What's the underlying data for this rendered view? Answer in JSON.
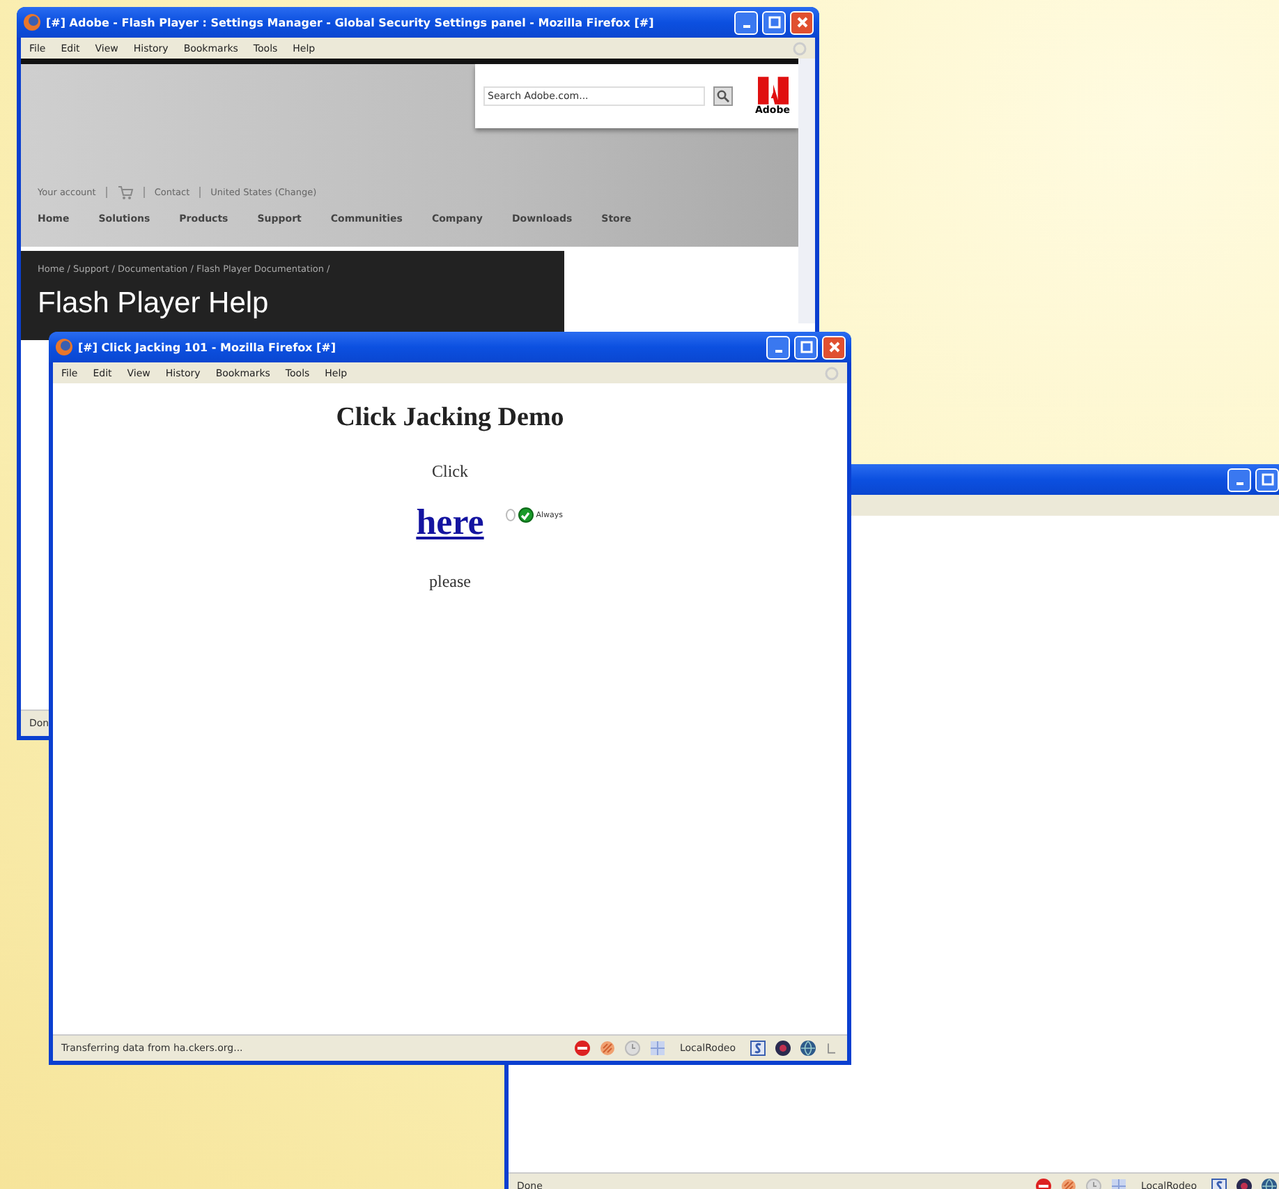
{
  "adobe_window": {
    "title": "[#] Adobe - Flash Player : Settings Manager - Global Security Settings panel - Mozilla Firefox [#]",
    "menu": [
      "File",
      "Edit",
      "View",
      "History",
      "Bookmarks",
      "Tools",
      "Help"
    ],
    "search": {
      "placeholder": "Search Adobe.com..."
    },
    "logo_text": "Adobe",
    "utility_links": [
      "Your account",
      "Contact",
      "United States (Change)"
    ],
    "nav": [
      "Home",
      "Solutions",
      "Products",
      "Support",
      "Communities",
      "Company",
      "Downloads",
      "Store"
    ],
    "breadcrumb": "Home / Support / Documentation / Flash Player Documentation /",
    "heading": "Flash Player Help",
    "status": "Don"
  },
  "blank_window": {
    "status": "Done",
    "status_addon": "LocalRodeo"
  },
  "demo_window": {
    "title": "[#] Click Jacking 101 - Mozilla Firefox [#]",
    "menu": [
      "File",
      "Edit",
      "View",
      "History",
      "Bookmarks",
      "Tools",
      "Help"
    ],
    "heading": "Click Jacking Demo",
    "line_before": "Click",
    "link": "here",
    "option": {
      "label": "Always",
      "checked": true,
      "selected": false
    },
    "line_after": "please",
    "status": "Transferring data from ha.ckers.org...",
    "status_addon": "LocalRodeo"
  }
}
